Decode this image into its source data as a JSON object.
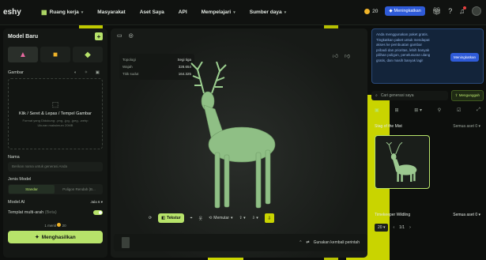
{
  "topbar": {
    "logo": "eshy",
    "nav": [
      {
        "label": "Ruang kerja",
        "dropdown": true
      },
      {
        "label": "Masyarakat",
        "dropdown": false
      },
      {
        "label": "Aset Saya",
        "dropdown": false
      },
      {
        "label": "API",
        "dropdown": false
      },
      {
        "label": "Mempelajari",
        "dropdown": true
      },
      {
        "label": "Sumber daya",
        "dropdown": true
      }
    ],
    "credits": "20",
    "upgrade_label": "Meningkatkan"
  },
  "left_panel": {
    "title": "Model Baru",
    "image_section_label": "Gambar",
    "upload_title": "Klik / Seret & Lepas / Tempel Gambar",
    "upload_hint": "Format yang Didukung: .png, .jpg, .jpeg, .webp Ukuran maksimum 20MB",
    "name_label": "Nama",
    "name_placeholder": "Berikan nama untuk generasi Anda",
    "model_type_label": "Jenis Model",
    "model_type_options": [
      "Standar",
      "Poligon Rendah (B..."
    ],
    "ai_model_label": "Model AI",
    "ai_model_value": "Jala 6",
    "multiview_label": "Templat multi-arah",
    "multiview_tag": "(Beta)",
    "cost_text": "1 menit",
    "cost_credits": "20",
    "generate_label": "Menghasilkan"
  },
  "viewer": {
    "stats": [
      {
        "label": "Topologi",
        "value": "Segi tiga"
      },
      {
        "label": "Wajah",
        "value": "328.654"
      },
      {
        "label": "Titik sudut",
        "value": "164.325"
      }
    ],
    "toolbar": {
      "texture_label": "Tekstur",
      "rig_label": "Memutar"
    },
    "reuse_label": "Gunakan kembali perintah"
  },
  "right_panel": {
    "promo_text": "Anda menggunakan paket gratis. Tingkatkan paket untuk mendapat akses ke pembuatan gambar pribadi dan prioritas, lebih banyak pilihan poligon, penelusuran ulang gratis, dan masih banyak lagi!",
    "promo_button": "Meningkatkan",
    "search_placeholder": "Cari generasi saya",
    "upload_button": "Mengunggah",
    "group1_title": "Stag of the Mist",
    "group1_sort": "Semua aset",
    "group1_count": "0",
    "group2_title": "Timekeeper Wildling",
    "group2_sort": "Semua aset",
    "group2_count": "0",
    "pager_size": "20",
    "pager_page": "1/1"
  },
  "colors": {
    "accent": "#b7e36a",
    "upgrade": "#2f5bd8",
    "deco_yellow": "#c9d400",
    "background": "#0d0f0d"
  }
}
